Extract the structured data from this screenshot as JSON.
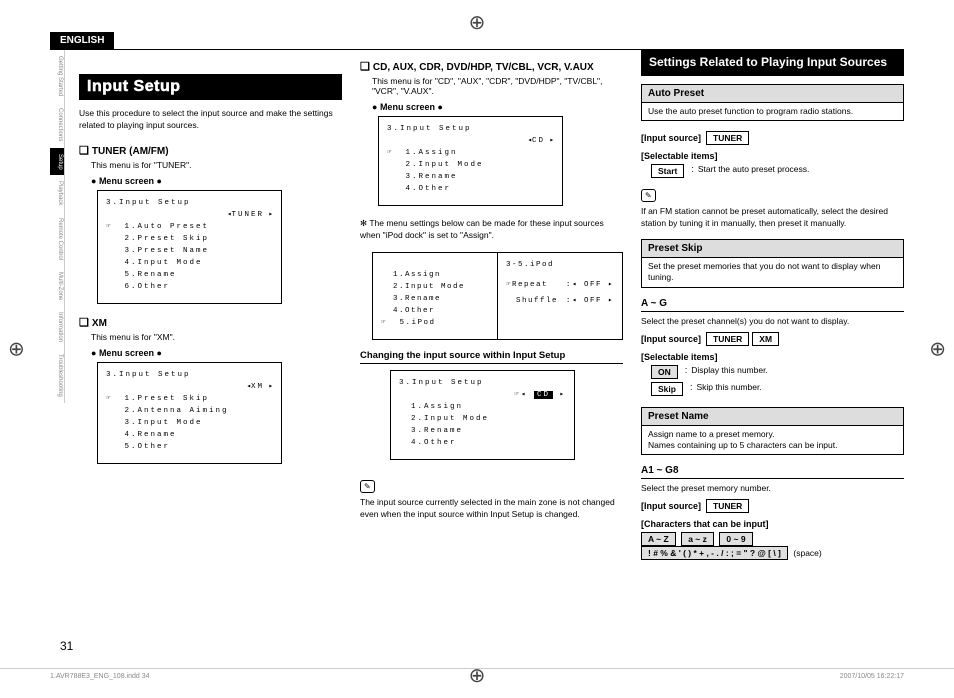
{
  "language": "ENGLISH",
  "side_tabs": [
    "Getting Started",
    "Connections",
    "Setup",
    "Playback",
    "Remote Control",
    "Multi-Zone",
    "Information",
    "Troubleshooting"
  ],
  "title": "Input Setup",
  "intro": "Use this procedure to select the input source and make the settings related to playing input sources.",
  "tuner": {
    "heading": "TUNER (AM/FM)",
    "desc": "This menu is for \"TUNER\".",
    "menu_label": "Menu screen",
    "screen": {
      "header": "3.Input Setup",
      "source": "TUNER",
      "items": [
        "1.Auto Preset",
        "2.Preset Skip",
        "3.Preset Name",
        "4.Input Mode",
        "5.Rename",
        "6.Other"
      ]
    }
  },
  "xm": {
    "heading": "XM",
    "desc": "This menu is for \"XM\".",
    "menu_label": "Menu screen",
    "screen": {
      "header": "3.Input Setup",
      "source": "XM",
      "items": [
        "1.Preset Skip",
        "2.Antenna Aiming",
        "3.Input Mode",
        "4.Rename",
        "5.Other"
      ]
    }
  },
  "cd": {
    "heading": "CD, AUX, CDR, DVD/HDP, TV/CBL, VCR, V.AUX",
    "desc": "This menu is for \"CD\", \"AUX\", \"CDR\", \"DVD/HDP\", \"TV/CBL\", \"VCR\", \"V.AUX\".",
    "menu_label": "Menu screen",
    "screen": {
      "header": "3.Input Setup",
      "source": "CD",
      "items": [
        "1.Assign",
        "2.Input Mode",
        "3.Rename",
        "4.Other"
      ]
    },
    "note_star": "The menu settings below can be made for these input sources when \"iPod dock\" is set to \"Assign\".",
    "dual": {
      "left": {
        "items": [
          "1.Assign",
          "2.Input Mode",
          "3.Rename",
          "4.Other",
          "5.iPod"
        ]
      },
      "right": {
        "header": "3-5.iPod",
        "rows": [
          {
            "label": "Repeat",
            "value": "OFF",
            "cursor": true
          },
          {
            "label": "Shuffle",
            "value": "OFF",
            "cursor": false
          }
        ]
      }
    }
  },
  "change": {
    "heading": "Changing the input source within Input Setup",
    "screen": {
      "header": "3.Input Setup",
      "source": "CD",
      "items": [
        "1.Assign",
        "2.Input Mode",
        "3.Rename",
        "4.Other"
      ]
    },
    "note": "The input source currently selected in the main zone is not changed even when the input source within Input Setup is changed."
  },
  "settings_title": "Settings Related to Playing Input Sources",
  "auto_preset": {
    "head": "Auto Preset",
    "body": "Use the auto preset function to program radio stations.",
    "input_source_label": "[Input source]",
    "sources": [
      "TUNER"
    ],
    "selectable_label": "[Selectable items]",
    "items": [
      {
        "name": "Start",
        "desc": "Start the auto preset process."
      }
    ],
    "note": "If an FM station cannot be preset automatically, select the desired station by tuning it in manually, then preset it manually."
  },
  "preset_skip": {
    "head": "Preset Skip",
    "body": "Set the preset memories that you do not want to display when tuning.",
    "range": "A ~ G",
    "range_desc": "Select the preset channel(s) you do not want to display.",
    "input_source_label": "[Input source]",
    "sources": [
      "TUNER",
      "XM"
    ],
    "selectable_label": "[Selectable items]",
    "items": [
      {
        "name": "ON",
        "desc": "Display this number.",
        "grey": true
      },
      {
        "name": "Skip",
        "desc": "Skip this number."
      }
    ]
  },
  "preset_name": {
    "head": "Preset Name",
    "body": "Assign name to a preset memory.\nNames containing up to 5 characters can be input.",
    "range": "A1 ~ G8",
    "range_desc": "Select the preset memory number.",
    "input_source_label": "[Input source]",
    "sources": [
      "TUNER"
    ],
    "chars_label": "[Characters that can be input]",
    "char_groups": [
      "A ~ Z",
      "a ~ z",
      "0 ~ 9",
      "! # % & ' ( ) * + , - . / : ; = \" ? @ [ \\ ]"
    ],
    "space_suffix": "(space)"
  },
  "page_number": "31",
  "footer": {
    "file": "1.AVR788E3_ENG_108.indd   34",
    "stamp": "2007/10/05   16:22:17"
  }
}
